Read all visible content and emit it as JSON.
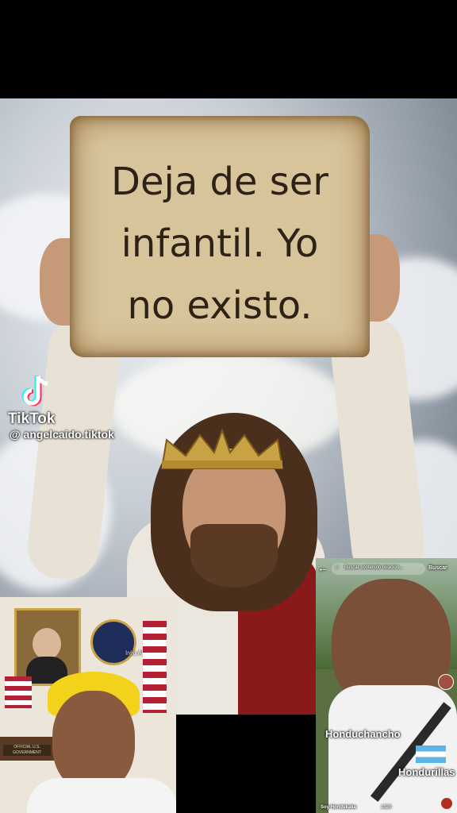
{
  "sign": {
    "line1": "Deja de ser",
    "line2": "infantil. Yo",
    "line3": "no existo."
  },
  "watermark": {
    "app_name": "TikTok",
    "username": "@ angelcaido.tiktok"
  },
  "inset_left": {
    "overlay_text": "Iréu Al",
    "nameplate": "OFFICIAL U.S. GOVERNMENT"
  },
  "inset_right": {
    "back_icon": "back-arrow-icon",
    "search_placeholder": "Buscar contenido relacion...",
    "search_button": "Buscar",
    "caption1": "Honduchancho",
    "caption2": "Hondurillas",
    "bottom_user": "Soy Hondukaka",
    "bottom_count": "1328"
  },
  "colors": {
    "sign": "#d8c49b",
    "sky": "#c9cfd6",
    "robe": "#ece7de",
    "sash": "#8a1a1a"
  }
}
